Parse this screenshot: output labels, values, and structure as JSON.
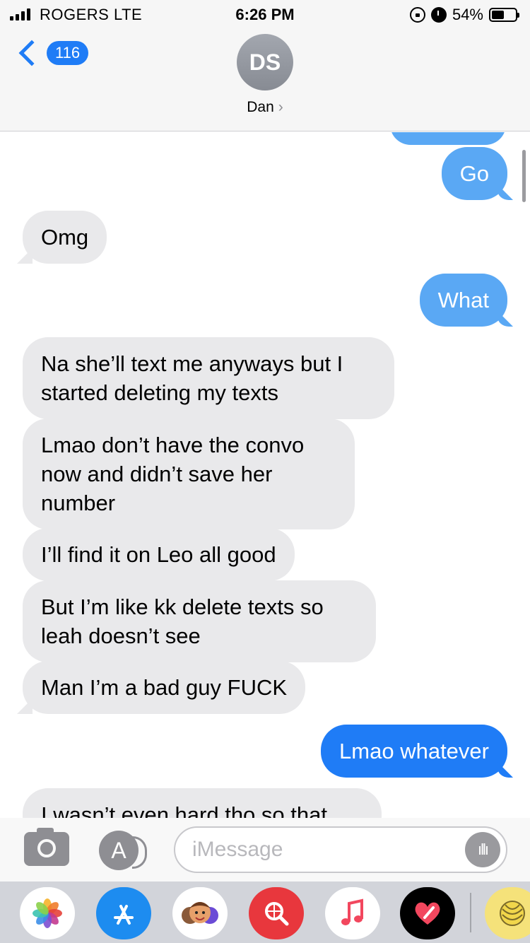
{
  "status_bar": {
    "carrier": "ROGERS  LTE",
    "time": "6:26 PM",
    "battery_percent": "54%",
    "battery_level": 0.54,
    "icons": [
      "signal-icon",
      "orientation-lock-icon",
      "alarm-icon",
      "battery-icon"
    ]
  },
  "header": {
    "back_count": "116",
    "avatar_initials": "DS",
    "contact_name": "Dan",
    "contact_chevron": "›"
  },
  "messages": [
    {
      "from": "me",
      "text": "Go"
    },
    {
      "from": "them",
      "text": "Omg"
    },
    {
      "from": "me",
      "text": "What"
    },
    {
      "from": "them",
      "text": "Na she’ll text me anyways but I started deleting my texts"
    },
    {
      "from": "them",
      "text": "Lmao don’t have the convo now and didn’t save her number"
    },
    {
      "from": "them",
      "text": "I’ll find it on Leo all good"
    },
    {
      "from": "them",
      "text": "But I’m like kk delete texts so leah doesn’t see"
    },
    {
      "from": "them",
      "text": "Man I’m a bad guy FUCK"
    },
    {
      "from": "me",
      "text": "Lmao whatever"
    },
    {
      "from": "them",
      "text": "I wasn’t even hard tho so that"
    }
  ],
  "input_bar": {
    "placeholder": "iMessage",
    "apps_glyph": "A",
    "audio_glyph": "ıllı"
  },
  "app_drawer": {
    "apps": [
      "photos-app-icon",
      "app-store-icon",
      "memoji-icon",
      "web-search-icon",
      "music-icon",
      "digital-touch-icon",
      "stickers-icon"
    ],
    "colors": {
      "accent": "#1f7cf6",
      "recv_bubble": "#e9e9eb"
    }
  }
}
